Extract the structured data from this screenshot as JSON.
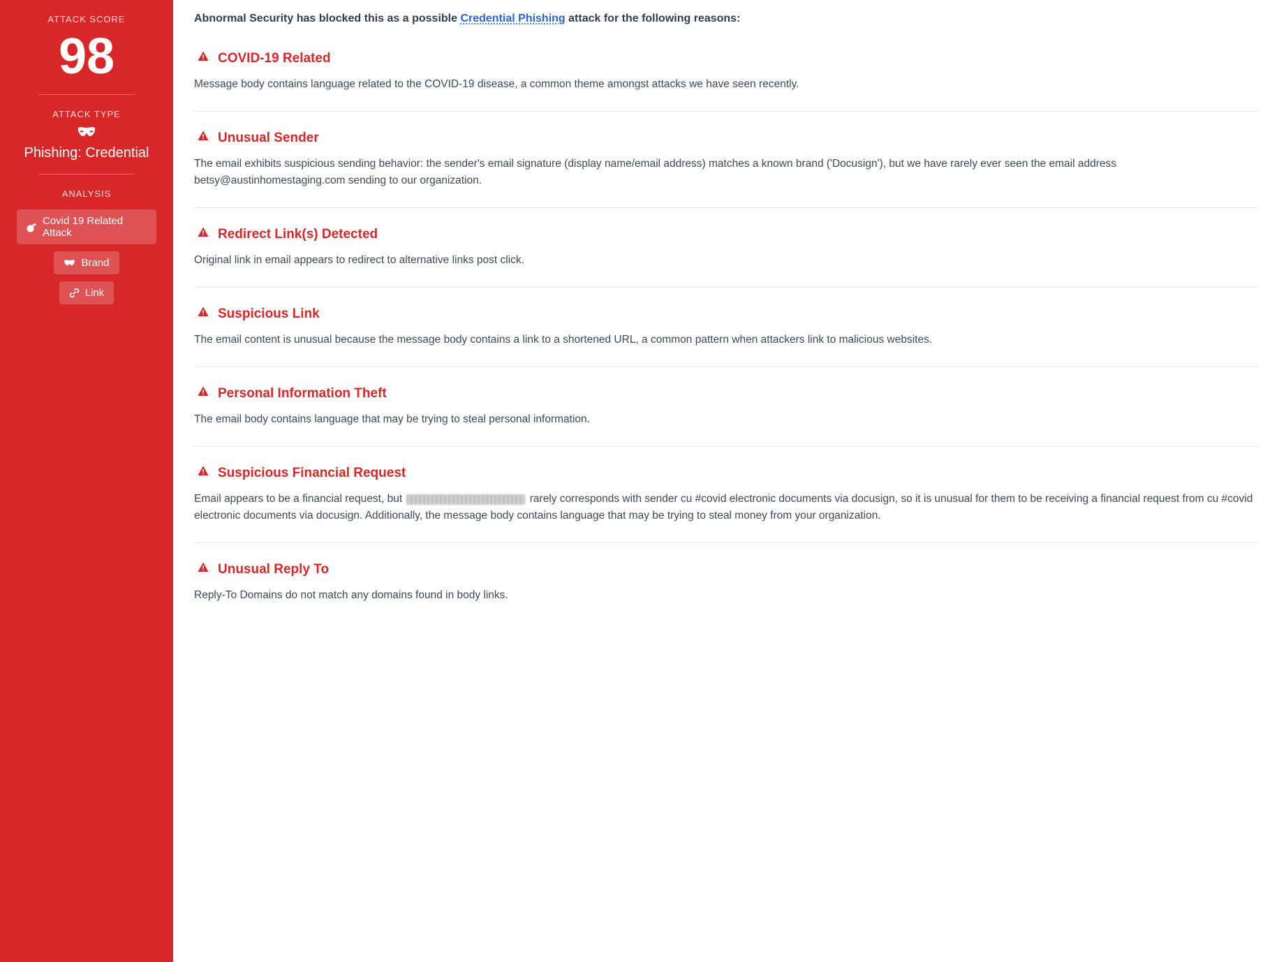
{
  "sidebar": {
    "score_label": "ATTACK SCORE",
    "score_value": "98",
    "type_label": "ATTACK TYPE",
    "type_value": "Phishing: Credential",
    "analysis_label": "ANALYSIS",
    "tags": {
      "covid": "Covid 19 Related Attack",
      "brand": "Brand",
      "link": "Link"
    }
  },
  "intro": {
    "prefix": "Abnormal Security has blocked this as a possible ",
    "link_text": "Credential Phishing",
    "suffix": " attack for the following reasons:"
  },
  "reasons": {
    "r0": {
      "title": "COVID-19 Related",
      "desc": "Message body contains language related to the COVID-19 disease, a common theme amongst attacks we have seen recently."
    },
    "r1": {
      "title": "Unusual Sender",
      "desc": "The email exhibits suspicious sending behavior: the sender's email signature (display name/email address) matches a known brand ('Docusign'), but we have rarely ever seen the email address betsy@austinhomestaging.com sending to our organization."
    },
    "r2": {
      "title": "Redirect Link(s) Detected",
      "desc": "Original link in email appears to redirect to alternative links post click."
    },
    "r3": {
      "title": "Suspicious Link",
      "desc": "The email content is unusual because the message body contains a link to a shortened URL, a common pattern when attackers link to malicious websites."
    },
    "r4": {
      "title": "Personal Information Theft",
      "desc": "The email body contains language that may be trying to steal personal information."
    },
    "r5": {
      "title": "Suspicious Financial Request",
      "desc_a": "Email appears to be a financial request, but ",
      "desc_b": " rarely corresponds with sender cu #covid electronic documents via docusign, so it is unusual for them to be receiving a financial request from cu #covid electronic documents via docusign. Additionally, the message body contains language that may be trying to steal money from your organization."
    },
    "r6": {
      "title": "Unusual Reply To",
      "desc": "Reply-To Domains do not match any domains found in body links."
    }
  }
}
